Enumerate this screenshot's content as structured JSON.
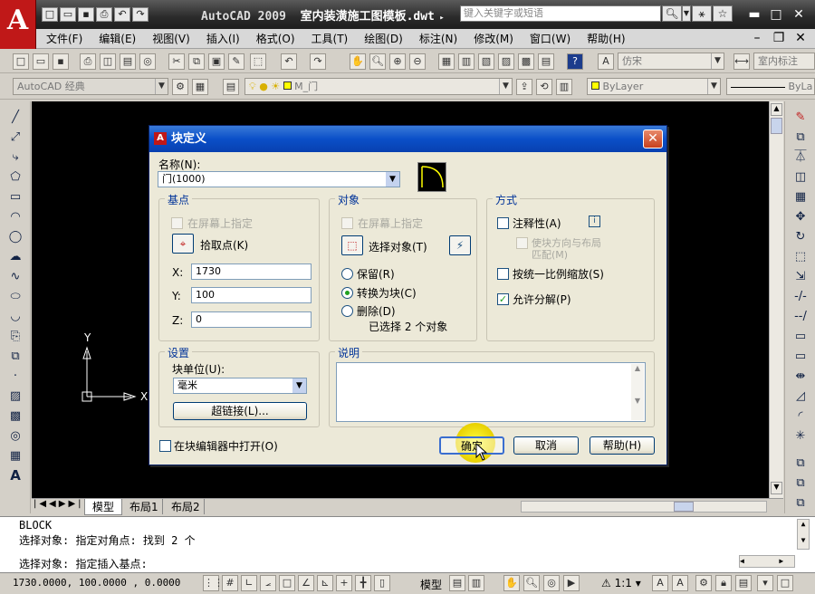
{
  "app": {
    "logo_letter": "A",
    "title_app": "AutoCAD 2009",
    "title_doc": "室内装潢施工图模板.dwt",
    "search_placeholder": "键入关键字或短语",
    "colors": {
      "accent": "#0a4fc8",
      "logo": "#c01818",
      "canvas": "#000000"
    }
  },
  "menu": [
    "文件(F)",
    "编辑(E)",
    "视图(V)",
    "插入(I)",
    "格式(O)",
    "工具(T)",
    "绘图(D)",
    "标注(N)",
    "修改(M)",
    "窗口(W)",
    "帮助(H)"
  ],
  "toolbar": {
    "font_combo": "仿宋",
    "dimstyle_combo": "室内标注",
    "workspace_combo": "AutoCAD 经典",
    "layer_combo": "M_门",
    "color_combo": "ByLayer",
    "linetype_combo": "ByLa"
  },
  "canvas": {
    "ucs_y": "Y",
    "ucs_x": "X"
  },
  "tabs": {
    "model": "模型",
    "layout1": "布局1",
    "layout2": "布局2"
  },
  "dialog": {
    "title": "块定义",
    "name_label": "名称(N):",
    "name_value": "门(1000)",
    "base": {
      "title": "基点",
      "on_screen": "在屏幕上指定",
      "pick_point": "拾取点(K)",
      "x_label": "X:",
      "x_value": "1730",
      "y_label": "Y:",
      "y_value": "100",
      "z_label": "Z:",
      "z_value": "0"
    },
    "objects": {
      "title": "对象",
      "on_screen": "在屏幕上指定",
      "select": "选择对象(T)",
      "retain": "保留(R)",
      "convert": "转换为块(C)",
      "delete": "删除(D)",
      "selected_count": "已选择 2 个对象"
    },
    "behavior": {
      "title": "方式",
      "annotative": "注释性(A)",
      "match_orient_1": "使块方向与布局",
      "match_orient_2": "匹配(M)",
      "scale_uniform": "按统一比例缩放(S)",
      "allow_explode": "允许分解(P)"
    },
    "settings": {
      "title": "设置",
      "unit_label": "块单位(U):",
      "unit_value": "毫米",
      "hyperlink": "超链接(L)..."
    },
    "description": {
      "title": "说明"
    },
    "open_in_editor": "在块编辑器中打开(O)",
    "ok": "确定",
    "cancel": "取消",
    "help": "帮助(H)"
  },
  "command": {
    "line1": "BLOCK",
    "line2": "选择对象: 指定对角点: 找到 2 个",
    "line3": "选择对象:  指定插入基点:"
  },
  "status": {
    "coords": "1730.0000, 100.0000 , 0.0000",
    "model": "模型",
    "scale": "1:1"
  }
}
